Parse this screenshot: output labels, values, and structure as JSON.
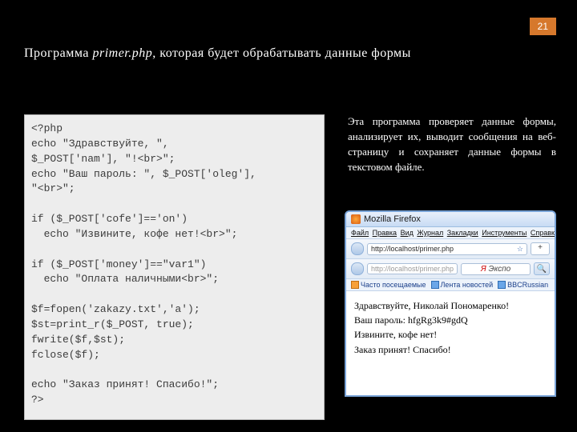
{
  "pageNumber": "21",
  "heading_before": "Программа ",
  "heading_em": "primer.php",
  "heading_after": ", которая будет обрабатывать  данные  формы",
  "code": "<?php\necho \"Здравствуйте, \",\n$_POST['nam'], \"!<br>\";\necho \"Ваш пароль: \", $_POST['oleg'],\n\"<br>\";\n\nif ($_POST['cofe']=='on')\n  echo \"Извините, кофе нет!<br>\";\n\nif ($_POST['money']==\"var1\")\n  echo \"Оплата наличными<br>\";\n\n$f=fopen('zakazy.txt','a');\n$st=print_r($_POST, true);\nfwrite($f,$st);\nfclose($f);\n\necho \"Заказ принят! Спасибо!\";\n?>",
  "description": "Эта программа проверяет данные формы, анализирует их, выводит сообщения на веб-страницу и сохраняет данные формы в текстовом файле.",
  "firefox": {
    "title": "Mozilla Firefox",
    "menu": [
      "Файл",
      "Правка",
      "Вид",
      "Журнал",
      "Закладки",
      "Инструменты",
      "Справка"
    ],
    "url": "http://localhost/primer.php",
    "tab_plus": "+",
    "searchLabel": "Экспо",
    "bookmarks": [
      "Часто посещаемые",
      "Лента новостей",
      "BBCRussian"
    ],
    "output": [
      "Здравствуйте, Николай Пономаренко!",
      "Ваш пароль: hfgRg3k9#gdQ",
      "Извините, кофе нет!",
      "Заказ принят! Спасибо!"
    ]
  }
}
